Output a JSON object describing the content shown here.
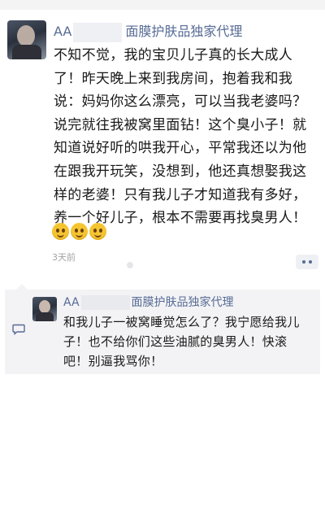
{
  "post": {
    "author_prefix": "AA",
    "author_suffix": "面膜护肤品独家代理",
    "text": "不知不觉，我的宝贝儿子真的长大成人了！昨天晚上来到我房间，抱着我和我说：妈妈你这么漂亮，可以当我老婆吗？说完就往我被窝里面钻！这个臭小子！就知道说好听的哄我开心，平常我还以为他在跟我开玩笑，没想到，他还真想娶我这样的老婆！只有我儿子才知道我有多好，养一个好儿子，根本不需要再找臭男人！",
    "emoji": [
      "smile-emoji",
      "smile-emoji",
      "smile-emoji"
    ],
    "time": "3天前"
  },
  "comment": {
    "author_prefix": "AA",
    "author_suffix": "面膜护肤品独家代理",
    "text": "和我儿子一被窝睡觉怎么了？我宁愿给我儿子！也不给你们这些油腻的臭男人！快滚吧！别逼我骂你！"
  },
  "icons": {
    "more": "more-dots-icon",
    "comment": "comment-bubble-icon"
  },
  "colors": {
    "name_link": "#576b95",
    "comment_bg": "#f3f3f5"
  }
}
